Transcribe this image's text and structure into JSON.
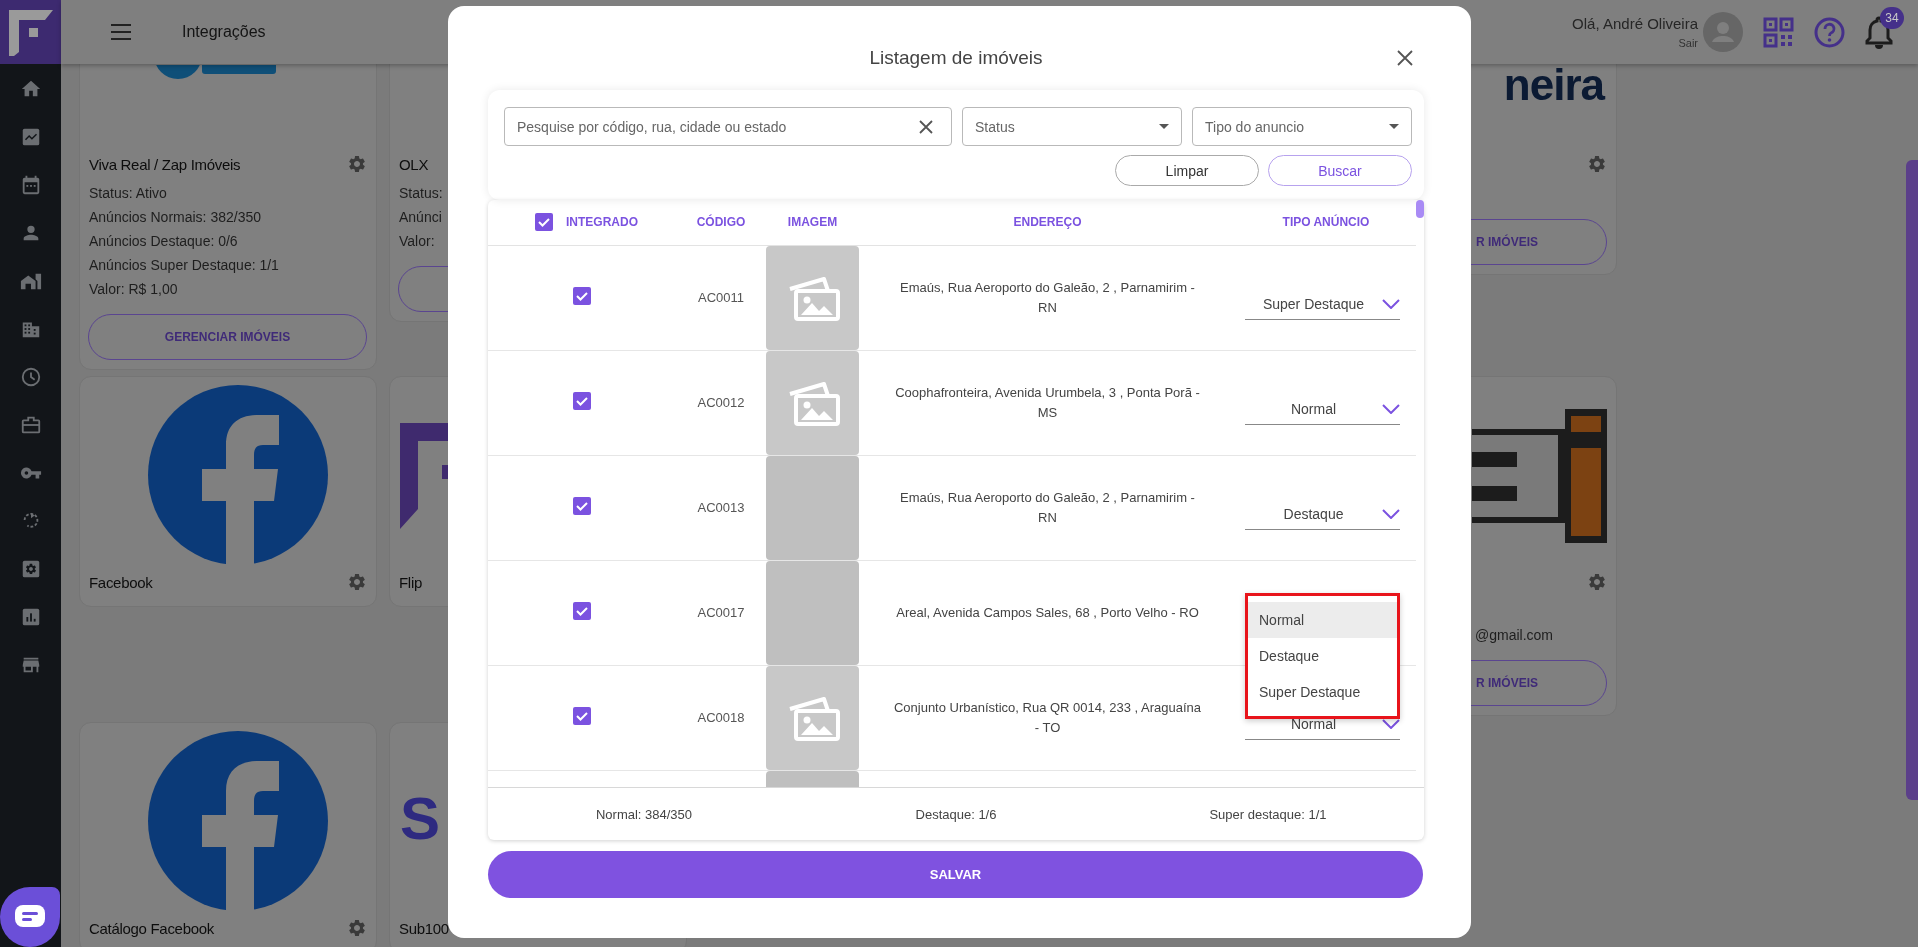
{
  "header": {
    "title": "Integrações",
    "greeting": "Olá, André Oliveira",
    "logout": "Sair",
    "notifications": "34"
  },
  "integrations": {
    "rows": [
      {
        "left": [
          {
            "kind": "vivareal",
            "title": "Viva Real / Zap Imóveis",
            "settings_icon": true,
            "lines": [
              "Status: Ativo",
              "Anúncios Normais: 382/350",
              "Anúncios Destaque: 0/6",
              "Anúncios Super Destaque: 1/1",
              "Valor: R$ 1,00"
            ],
            "has_button": true,
            "button_label": "GERENCIAR IMÓVEIS"
          },
          {
            "kind": "plain",
            "title": "OLX",
            "lines": [
              "Status:",
              "Anúnci",
              "Valor:"
            ],
            "has_button": true
          }
        ],
        "right": [
          {
            "kind": "wordmark",
            "logo_text": "neira",
            "settings_icon": true,
            "has_button": true,
            "button_label": "R IMÓVEIS"
          }
        ]
      },
      {
        "left": [
          {
            "kind": "round",
            "title": "Facebook",
            "settings_icon": true
          },
          {
            "kind": "flip",
            "title": "Flip"
          }
        ],
        "right": [
          {
            "kind": "blocks",
            "settings_icon": true,
            "lines": [
              "@gmail.com"
            ],
            "has_button": true,
            "button_label": "R IMÓVEIS"
          }
        ]
      },
      {
        "left": [
          {
            "kind": "round",
            "title": "Catálogo Facebook",
            "settings_icon": true
          },
          {
            "kind": "bigword",
            "logo_text": "S",
            "title": "Sub100"
          }
        ]
      }
    ]
  },
  "modal": {
    "title": "Listagem de imóveis",
    "search": {
      "placeholder": "Pesquise por código, rua, cidade ou estado"
    },
    "filters": [
      {
        "placeholder": "Status"
      },
      {
        "placeholder": "Tipo do anuncio"
      }
    ],
    "buttons": [
      {
        "label": "Limpar",
        "kind": "neutral"
      },
      {
        "label": "Buscar",
        "kind": "accent"
      }
    ],
    "table": {
      "all_checked": true,
      "columns": [
        "INTEGRADO",
        "CÓDIGO",
        "IMAGEM",
        "ENDEREÇO",
        "TIPO ANÚNCIO"
      ],
      "rows": [
        {
          "kind": "icon",
          "checked": true,
          "code": "AC0011",
          "address": "Emaús, Rua Aeroporto do Galeão, 2 , Parnamirim - RN",
          "ad_type": "Super Destaque"
        },
        {
          "kind": "icon",
          "checked": true,
          "code": "AC0012",
          "address": "Coophafronteira, Avenida Urumbela, 3 , Ponta Porã - MS",
          "ad_type": "Normal"
        },
        {
          "kind": "blank",
          "checked": true,
          "code": "AC0013",
          "address": "Emaús, Rua Aeroporto do Galeão, 2 , Parnamirim - RN",
          "ad_type": "Destaque"
        },
        {
          "kind": "blank",
          "checked": true,
          "code": "AC0017",
          "address": "Areal, Avenida Campos Sales, 68 , Porto Velho - RO",
          "dropdown": {
            "options": [
              {
                "label": "Normal",
                "selected": true
              },
              {
                "label": "Destaque",
                "selected": false
              },
              {
                "label": "Super Destaque",
                "selected": false
              }
            ]
          }
        },
        {
          "kind": "icon",
          "checked": true,
          "code": "AC0018",
          "address": "Conjunto Urbanístico, Rua QR 0014, 233 , Araguaína - TO",
          "ad_type": "Normal"
        },
        {
          "kind": "blank"
        }
      ]
    },
    "totals": [
      "Normal: 384/350",
      "Destaque: 1/6",
      "Super destaque: 1/1"
    ],
    "save": "SALVAR"
  }
}
